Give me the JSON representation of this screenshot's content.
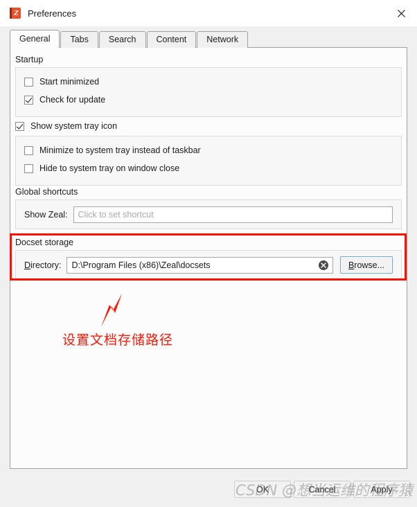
{
  "window": {
    "title": "Preferences",
    "icon": "zeal-book-icon",
    "icon_letter": "Z",
    "close_label": "close-icon"
  },
  "tabs": [
    {
      "label": "General",
      "active": true
    },
    {
      "label": "Tabs",
      "active": false
    },
    {
      "label": "Search",
      "active": false
    },
    {
      "label": "Content",
      "active": false
    },
    {
      "label": "Network",
      "active": false
    }
  ],
  "startup": {
    "title": "Startup",
    "options": [
      {
        "label": "Start minimized",
        "checked": false
      },
      {
        "label": "Check for update",
        "checked": true
      }
    ]
  },
  "system_tray": {
    "main": {
      "label": "Show system tray icon",
      "checked": true
    },
    "options": [
      {
        "label": "Minimize to system tray instead of taskbar",
        "checked": false
      },
      {
        "label": "Hide to system tray on window close",
        "checked": false
      }
    ]
  },
  "global_shortcuts": {
    "title": "Global shortcuts",
    "show_zeal_label": "Show Zeal:",
    "show_zeal_value": "",
    "show_zeal_placeholder": "Click to set shortcut"
  },
  "docset_storage": {
    "title": "Docset storage",
    "directory_label_accel": "D",
    "directory_label_rest": "irectory:",
    "directory_value": "D:\\Program Files (x86)\\Zeal\\docsets",
    "clear_icon": "clear-circle-icon",
    "browse_accel": "B",
    "browse_rest": "rowse...",
    "highlight_color": "#fc1105"
  },
  "annotation": {
    "text": "设置文档存储路径",
    "color": "#fd1b09",
    "arrow": "up-right-arrow"
  },
  "buttons": [
    {
      "label": "OK"
    },
    {
      "label": "Cancel"
    },
    {
      "label": "Apply"
    }
  ],
  "watermark": {
    "text": "CSDN @想当运维的程序猿"
  }
}
